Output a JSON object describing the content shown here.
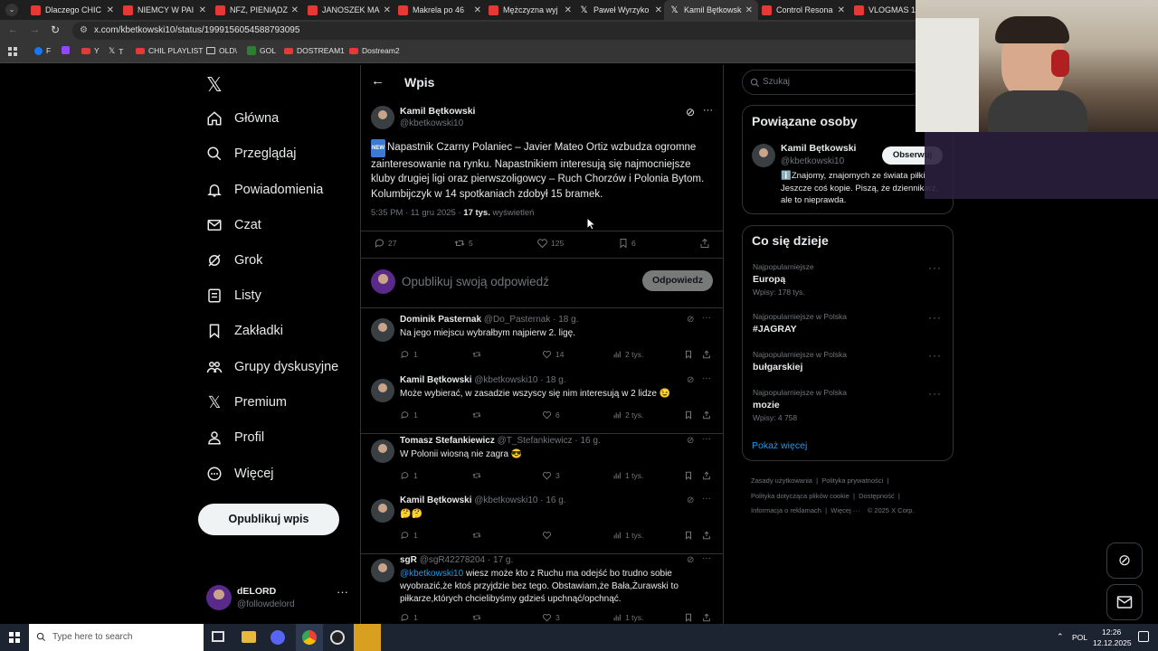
{
  "browser": {
    "tabs": [
      {
        "title": "Dlaczego CHIC",
        "icon": "youtube-icon"
      },
      {
        "title": "NIEMCY W PAI",
        "icon": "youtube-icon"
      },
      {
        "title": "NFZ, PIENIĄDZ",
        "icon": "youtube-icon"
      },
      {
        "title": "JANOSZEK MA",
        "icon": "youtube-icon"
      },
      {
        "title": "Makrela po 46",
        "icon": "youtube-icon"
      },
      {
        "title": "Mężczyzna wyj",
        "icon": "youtube-icon"
      },
      {
        "title": "Paweł Wyrzyko",
        "icon": "x-icon"
      },
      {
        "title": "Kamil Bętkowsk",
        "icon": "x-icon",
        "active": true
      },
      {
        "title": "Control Resona",
        "icon": "youtube-icon"
      },
      {
        "title": "VLOGMAS 10",
        "icon": "youtube-icon"
      }
    ],
    "url": "x.com/kbetkowski10/status/1999156054588793095",
    "bookmarks": [
      "F",
      "",
      "Y",
      "T",
      "CHIL PLAYLIST",
      "OLD\\",
      "GOL",
      "DOSTREAM1",
      "Dostream2"
    ]
  },
  "nav": {
    "items": [
      "Główna",
      "Przeglądaj",
      "Powiadomienia",
      "Czat",
      "Grok",
      "Listy",
      "Zakładki",
      "Grupy dyskusyjne",
      "Premium",
      "Profil",
      "Więcej"
    ],
    "post_button": "Opublikuj wpis",
    "account_name": "dELORD",
    "account_handle": "@followdelord"
  },
  "main": {
    "title": "Wpis",
    "post": {
      "author": "Kamil Bętkowski",
      "handle": "@kbetkowski10",
      "badge": "NEW",
      "text": "Napastnik Czarny Polaniec – Javier Mateo Ortiz wzbudza ogromne zainteresowanie na rynku. Napastnikiem interesują się najmocniejsze kluby drugiej ligi oraz pierwszoligowcy – Ruch Chorzów i Polonia Bytom. Kolumbijczyk w 14 spotkaniach zdobył 15 bramek.",
      "timestamp": "5:35 PM · 11 gru 2025 ·",
      "views_count": "17 tys.",
      "views_label": "wyświetleń",
      "stats": {
        "replies": "27",
        "reposts": "5",
        "likes": "125",
        "bookmarks": "6"
      }
    },
    "composer": {
      "placeholder": "Opublikuj swoją odpowiedź",
      "button": "Odpowiedz"
    },
    "replies": [
      {
        "name": "Dominik Pasternak",
        "meta": "@Do_Pasternak · 18 g.",
        "text": "Na jego miejscu wybrałbym najpierw 2. ligę.",
        "replies": "1",
        "reposts": "",
        "likes": "14",
        "views": "2 tys."
      },
      {
        "name": "Kamil Bętkowski",
        "meta": "@kbetkowski10 · 18 g.",
        "text": "Może wybierać, w zasadzie wszyscy się nim interesują w 2 lidze 😉",
        "replies": "1",
        "reposts": "",
        "likes": "6",
        "views": "2 tys."
      },
      {
        "name": "Tomasz Stefankiewicz",
        "meta": "@T_Stefankiewicz · 16 g.",
        "text": "W Polonii wiosną nie zagra 😎",
        "replies": "1",
        "reposts": "",
        "likes": "3",
        "views": "1 tys."
      },
      {
        "name": "Kamil Bętkowski",
        "meta": "@kbetkowski10 · 16 g.",
        "text": "🤔🤔",
        "replies": "1",
        "reposts": "",
        "likes": "",
        "views": "1 tys."
      },
      {
        "name": "sgR",
        "meta": "@sgR42278204 · 17 g.",
        "mention": "@kbetkowski10",
        "text": "wiesz może kto z Ruchu ma odejść bo trudno sobie wyobrazić,że ktoś przyjdzie bez tego. Obstawiam,że Bała,Żurawski to piłkarze,których chcielibyśmy gdzieś upchnąć/opchnąć.",
        "replies": "1",
        "reposts": "",
        "likes": "3",
        "views": "1 tys."
      }
    ]
  },
  "right": {
    "search_placeholder": "Szukaj",
    "related_title": "Powiązane osoby",
    "related": {
      "name": "Kamil Bętkowski",
      "handle": "@kbetkowski10",
      "follow": "Obserwuj",
      "bio": "ℹ️Znajomy, znajomych ze świata piłki. Jeszcze coś kopie. Piszą, że dziennikarz, ale to nieprawda."
    },
    "trends_title": "Co się dzieje",
    "trends": [
      {
        "context": "Najpopularniejsze",
        "name": "Europą",
        "count": "Wpisy: 178 tys."
      },
      {
        "context": "Najpopularniejsze w Polska",
        "name": "#JAGRAY",
        "count": ""
      },
      {
        "context": "Najpopularniejsze w Polska",
        "name": "bułgarskiej",
        "count": ""
      },
      {
        "context": "Najpopularniejsze w Polska",
        "name": "mozie",
        "count": "Wpisy: 4 758"
      }
    ],
    "show_more": "Pokaż więcej",
    "footer": [
      "Zasady użytkowania",
      "Polityka prywatności",
      "Polityka dotycząca plików cookie",
      "Dostępność",
      "Informacja o reklamach",
      "Więcej ···",
      "© 2025 X Corp."
    ]
  },
  "taskbar": {
    "search_placeholder": "Type here to search",
    "lang": "POL",
    "time": "12:26",
    "date": "12.12.2025"
  }
}
